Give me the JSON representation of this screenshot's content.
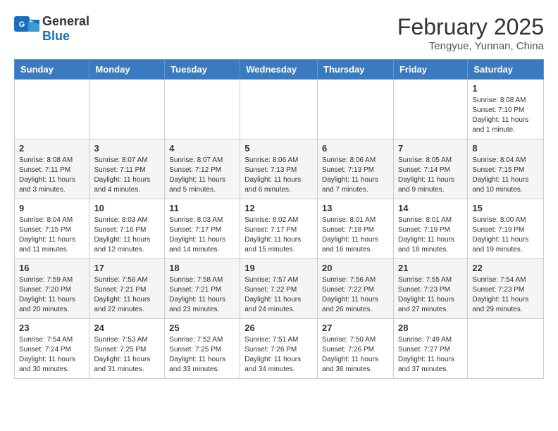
{
  "header": {
    "logo_line1": "General",
    "logo_line2": "Blue",
    "month_title": "February 2025",
    "subtitle": "Tengyue, Yunnan, China"
  },
  "weekdays": [
    "Sunday",
    "Monday",
    "Tuesday",
    "Wednesday",
    "Thursday",
    "Friday",
    "Saturday"
  ],
  "weeks": [
    [
      {
        "day": "",
        "info": ""
      },
      {
        "day": "",
        "info": ""
      },
      {
        "day": "",
        "info": ""
      },
      {
        "day": "",
        "info": ""
      },
      {
        "day": "",
        "info": ""
      },
      {
        "day": "",
        "info": ""
      },
      {
        "day": "1",
        "info": "Sunrise: 8:08 AM\nSunset: 7:10 PM\nDaylight: 11 hours\nand 1 minute."
      }
    ],
    [
      {
        "day": "2",
        "info": "Sunrise: 8:08 AM\nSunset: 7:11 PM\nDaylight: 11 hours\nand 3 minutes."
      },
      {
        "day": "3",
        "info": "Sunrise: 8:07 AM\nSunset: 7:11 PM\nDaylight: 11 hours\nand 4 minutes."
      },
      {
        "day": "4",
        "info": "Sunrise: 8:07 AM\nSunset: 7:12 PM\nDaylight: 11 hours\nand 5 minutes."
      },
      {
        "day": "5",
        "info": "Sunrise: 8:06 AM\nSunset: 7:13 PM\nDaylight: 11 hours\nand 6 minutes."
      },
      {
        "day": "6",
        "info": "Sunrise: 8:06 AM\nSunset: 7:13 PM\nDaylight: 11 hours\nand 7 minutes."
      },
      {
        "day": "7",
        "info": "Sunrise: 8:05 AM\nSunset: 7:14 PM\nDaylight: 11 hours\nand 9 minutes."
      },
      {
        "day": "8",
        "info": "Sunrise: 8:04 AM\nSunset: 7:15 PM\nDaylight: 11 hours\nand 10 minutes."
      }
    ],
    [
      {
        "day": "9",
        "info": "Sunrise: 8:04 AM\nSunset: 7:15 PM\nDaylight: 11 hours\nand 11 minutes."
      },
      {
        "day": "10",
        "info": "Sunrise: 8:03 AM\nSunset: 7:16 PM\nDaylight: 11 hours\nand 12 minutes."
      },
      {
        "day": "11",
        "info": "Sunrise: 8:03 AM\nSunset: 7:17 PM\nDaylight: 11 hours\nand 14 minutes."
      },
      {
        "day": "12",
        "info": "Sunrise: 8:02 AM\nSunset: 7:17 PM\nDaylight: 11 hours\nand 15 minutes."
      },
      {
        "day": "13",
        "info": "Sunrise: 8:01 AM\nSunset: 7:18 PM\nDaylight: 11 hours\nand 16 minutes."
      },
      {
        "day": "14",
        "info": "Sunrise: 8:01 AM\nSunset: 7:19 PM\nDaylight: 11 hours\nand 18 minutes."
      },
      {
        "day": "15",
        "info": "Sunrise: 8:00 AM\nSunset: 7:19 PM\nDaylight: 11 hours\nand 19 minutes."
      }
    ],
    [
      {
        "day": "16",
        "info": "Sunrise: 7:59 AM\nSunset: 7:20 PM\nDaylight: 11 hours\nand 20 minutes."
      },
      {
        "day": "17",
        "info": "Sunrise: 7:58 AM\nSunset: 7:21 PM\nDaylight: 11 hours\nand 22 minutes."
      },
      {
        "day": "18",
        "info": "Sunrise: 7:58 AM\nSunset: 7:21 PM\nDaylight: 11 hours\nand 23 minutes."
      },
      {
        "day": "19",
        "info": "Sunrise: 7:57 AM\nSunset: 7:22 PM\nDaylight: 11 hours\nand 24 minutes."
      },
      {
        "day": "20",
        "info": "Sunrise: 7:56 AM\nSunset: 7:22 PM\nDaylight: 11 hours\nand 26 minutes."
      },
      {
        "day": "21",
        "info": "Sunrise: 7:55 AM\nSunset: 7:23 PM\nDaylight: 11 hours\nand 27 minutes."
      },
      {
        "day": "22",
        "info": "Sunrise: 7:54 AM\nSunset: 7:23 PM\nDaylight: 11 hours\nand 29 minutes."
      }
    ],
    [
      {
        "day": "23",
        "info": "Sunrise: 7:54 AM\nSunset: 7:24 PM\nDaylight: 11 hours\nand 30 minutes."
      },
      {
        "day": "24",
        "info": "Sunrise: 7:53 AM\nSunset: 7:25 PM\nDaylight: 11 hours\nand 31 minutes."
      },
      {
        "day": "25",
        "info": "Sunrise: 7:52 AM\nSunset: 7:25 PM\nDaylight: 11 hours\nand 33 minutes."
      },
      {
        "day": "26",
        "info": "Sunrise: 7:51 AM\nSunset: 7:26 PM\nDaylight: 11 hours\nand 34 minutes."
      },
      {
        "day": "27",
        "info": "Sunrise: 7:50 AM\nSunset: 7:26 PM\nDaylight: 11 hours\nand 36 minutes."
      },
      {
        "day": "28",
        "info": "Sunrise: 7:49 AM\nSunset: 7:27 PM\nDaylight: 11 hours\nand 37 minutes."
      },
      {
        "day": "",
        "info": ""
      }
    ]
  ]
}
